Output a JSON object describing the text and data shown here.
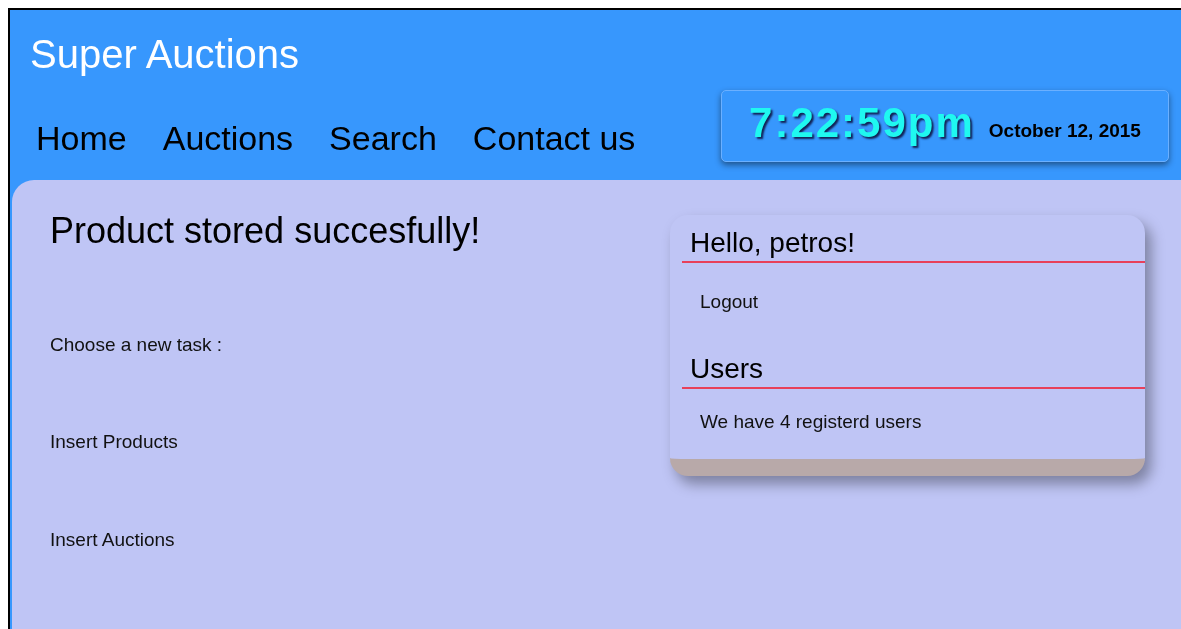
{
  "site_title": "Super Auctions",
  "nav": [
    {
      "label": "Home"
    },
    {
      "label": "Auctions"
    },
    {
      "label": "Search"
    },
    {
      "label": "Contact us"
    }
  ],
  "clock": {
    "time": "7:22:59pm",
    "date": "October 12, 2015"
  },
  "main": {
    "heading": "Product stored succesfully!",
    "prompt": "Choose a new task :",
    "tasks": [
      "Insert Products",
      "Insert Auctions"
    ]
  },
  "sidebar": {
    "sections": [
      {
        "title": "Hello, petros!",
        "kind": "link",
        "text": "Logout"
      },
      {
        "title": "Users",
        "kind": "text",
        "text": "We have 4 registerd users"
      }
    ]
  }
}
